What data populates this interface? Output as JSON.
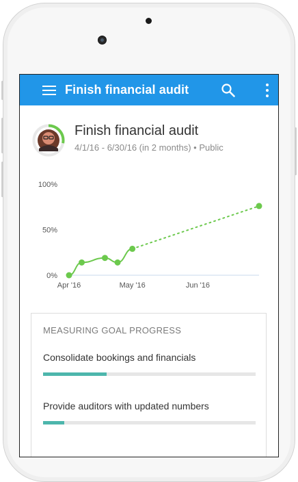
{
  "app": {
    "title": "Finish financial audit"
  },
  "goal": {
    "title": "Finish financial audit",
    "meta": "4/1/16 - 6/30/16 (in 2 months) • Public",
    "progress": 0.28,
    "avatar": "user-avatar"
  },
  "icons": {
    "menu": "hamburger-menu-icon",
    "search": "search-icon",
    "more": "more-vertical-icon"
  },
  "colors": {
    "appbar": "#2196e8",
    "progress_ring": "#6cc94d",
    "line": "#6cc94d",
    "bar_fill": "#4db6ac"
  },
  "chart_data": {
    "type": "line",
    "y_tick_labels": [
      "100%",
      "50%",
      "0%"
    ],
    "x_tick_labels": [
      "Apr '16",
      "May '16",
      "Jun '16"
    ],
    "ylim": [
      0,
      100
    ],
    "series": [
      {
        "values": [
          {
            "x": "2016-04-01",
            "y": 0
          },
          {
            "x": "2016-04-07",
            "y": 14
          },
          {
            "x": "2016-04-18",
            "y": 19
          },
          {
            "x": "2016-04-24",
            "y": 14
          },
          {
            "x": "2016-05-01",
            "y": 29
          }
        ]
      },
      {
        "style": "dotted",
        "values": [
          {
            "x": "2016-05-01",
            "y": 29
          },
          {
            "x": "2016-06-30",
            "y": 76
          }
        ]
      }
    ]
  },
  "measuring": {
    "heading": "MEASURING GOAL PROGRESS",
    "items": [
      {
        "label": "Consolidate bookings and financials",
        "progress": 0.3
      },
      {
        "label": "Provide auditors with updated numbers",
        "progress": 0.1
      }
    ]
  }
}
